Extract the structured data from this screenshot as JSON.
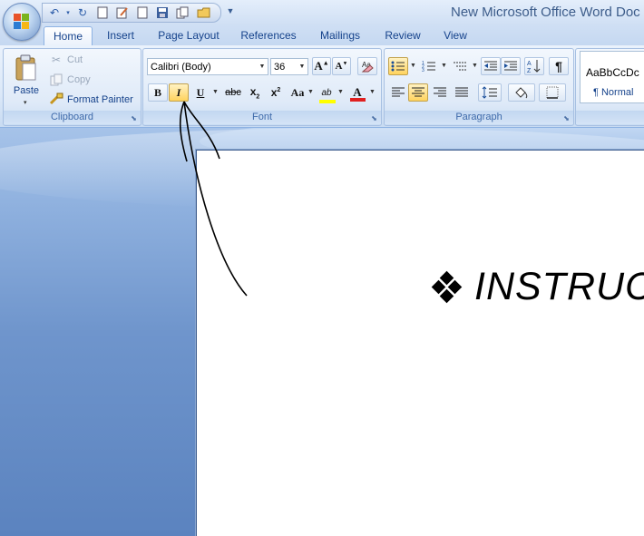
{
  "window": {
    "title": "New Microsoft Office Word Doc"
  },
  "quick_access": {
    "buttons": [
      "undo-icon",
      "dropdown-arrow-icon",
      "redo-icon",
      "new-document-icon",
      "edit-icon",
      "blank-page-icon",
      "save-icon",
      "copy-pages-icon",
      "open-folder-icon",
      "dropdown-arrow-icon"
    ]
  },
  "tabs": [
    {
      "label": "Home",
      "active": true
    },
    {
      "label": "Insert"
    },
    {
      "label": "Page Layout"
    },
    {
      "label": "References"
    },
    {
      "label": "Mailings"
    },
    {
      "label": "Review"
    },
    {
      "label": "View"
    }
  ],
  "clipboard": {
    "group_label": "Clipboard",
    "paste_label": "Paste",
    "cut_label": "Cut",
    "copy_label": "Copy",
    "format_painter_label": "Format Painter"
  },
  "font": {
    "group_label": "Font",
    "font_name": "Calibri (Body)",
    "font_size": "36",
    "bold_glyph": "B",
    "italic_glyph": "I",
    "underline_glyph": "U",
    "strike_glyph": "abc",
    "change_case_glyph": "Aa",
    "highlight_glyph": "ab",
    "color_glyph": "A",
    "highlight_color": "#ffff00",
    "font_color": "#e02020"
  },
  "paragraph": {
    "group_label": "Paragraph"
  },
  "styles": {
    "sample": "AaBbCcDc",
    "name": "¶ Normal"
  },
  "document": {
    "text": "INSTRUC",
    "bullet_icon": "four-diamond-bullet-icon"
  },
  "colors": {
    "ribbon_text": "#15428b",
    "accent_highlight": "#ffd35e"
  }
}
